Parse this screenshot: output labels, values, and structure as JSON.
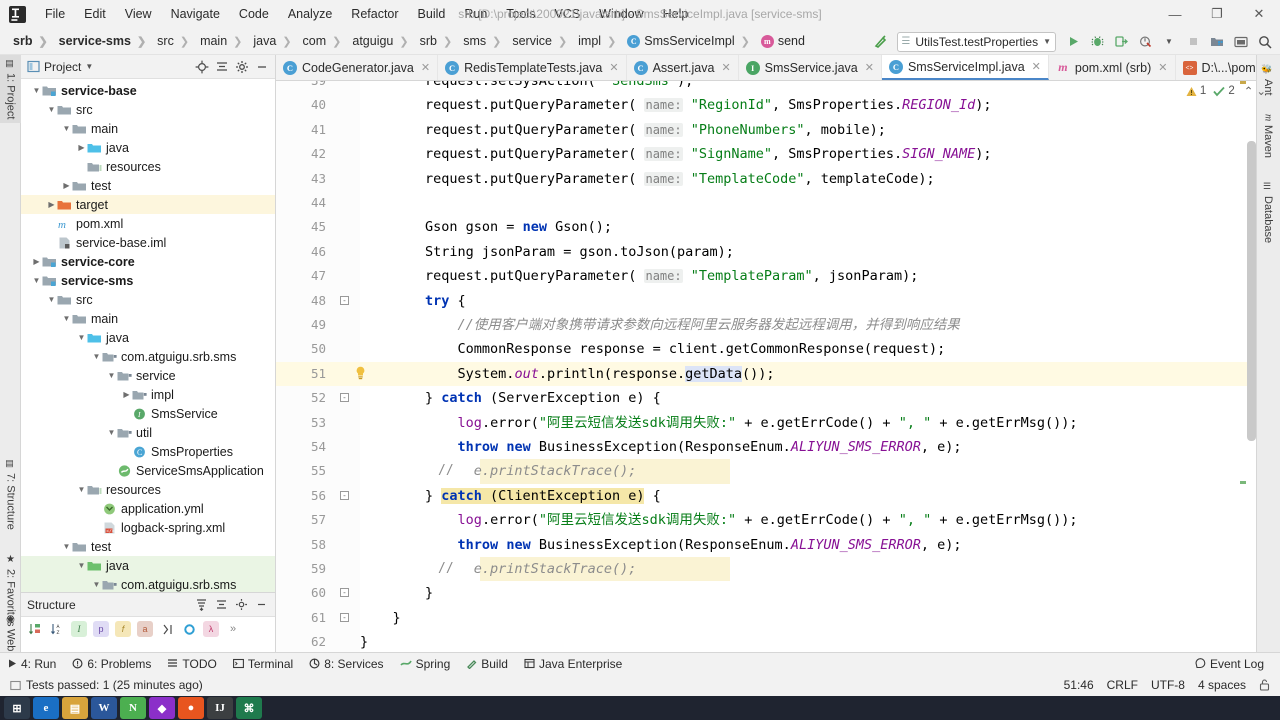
{
  "window": {
    "title": "srb [D:\\project\\200921\\java\\srb] - SmsServiceImpl.java [service-sms]",
    "minimize": "—",
    "maximize": "❐",
    "close": "✕"
  },
  "menubar": {
    "items": [
      {
        "label": "File"
      },
      {
        "label": "Edit"
      },
      {
        "label": "View"
      },
      {
        "label": "Navigate"
      },
      {
        "label": "Code"
      },
      {
        "label": "Analyze"
      },
      {
        "label": "Refactor"
      },
      {
        "label": "Build"
      },
      {
        "label": "Run"
      },
      {
        "label": "Tools"
      },
      {
        "label": "VCS"
      },
      {
        "label": "Window"
      },
      {
        "label": "Help"
      }
    ]
  },
  "breadcrumbs": {
    "items": [
      {
        "label": "srb",
        "bold": true,
        "icon": ""
      },
      {
        "label": "service-sms",
        "bold": true,
        "icon": ""
      },
      {
        "label": "src",
        "bold": false,
        "icon": ""
      },
      {
        "label": "main",
        "bold": false,
        "icon": ""
      },
      {
        "label": "java",
        "bold": false,
        "icon": ""
      },
      {
        "label": "com",
        "bold": false,
        "icon": ""
      },
      {
        "label": "atguigu",
        "bold": false,
        "icon": ""
      },
      {
        "label": "srb",
        "bold": false,
        "icon": ""
      },
      {
        "label": "sms",
        "bold": false,
        "icon": ""
      },
      {
        "label": "service",
        "bold": false,
        "icon": ""
      },
      {
        "label": "impl",
        "bold": false,
        "icon": ""
      },
      {
        "label": "SmsServiceImpl",
        "bold": false,
        "icon": "class-icon"
      },
      {
        "label": "send",
        "bold": false,
        "icon": "method-icon"
      }
    ]
  },
  "toolbar": {
    "run_config": "UtilsTest.testProperties",
    "icons": [
      "build-icon",
      "run-icon",
      "debug-icon",
      "run-coverage-icon",
      "profile-icon",
      "stop-icon",
      "project-structure-icon",
      "settings-layout-icon",
      "search-icon"
    ]
  },
  "left_tool_strip": {
    "tabs": [
      {
        "label": "1: Project",
        "selected": true,
        "icon": "project-icon"
      },
      {
        "label": "7: Structure",
        "selected": false,
        "icon": "structure-icon"
      },
      {
        "label": "2: Favorites",
        "selected": false,
        "icon": "star-icon"
      },
      {
        "label": "Web",
        "selected": false,
        "icon": "web-icon"
      }
    ]
  },
  "right_tool_strip": {
    "tabs": [
      {
        "label": "Ant",
        "icon": "ant-icon"
      },
      {
        "label": "Maven",
        "icon": "maven-icon"
      },
      {
        "label": "Database",
        "icon": "database-icon"
      }
    ]
  },
  "project_panel": {
    "title": "Project",
    "actions": [
      "locate-icon",
      "expand-collapse-icon",
      "gear-icon",
      "minimize-icon"
    ],
    "tree": [
      {
        "depth": 1,
        "arrow": "down",
        "icon": "module-icon",
        "label": "service-base",
        "bold": true,
        "hl": ""
      },
      {
        "depth": 2,
        "arrow": "down",
        "icon": "folder-icon",
        "label": "src",
        "bold": false,
        "hl": ""
      },
      {
        "depth": 3,
        "arrow": "down",
        "icon": "folder-icon",
        "label": "main",
        "bold": false,
        "hl": ""
      },
      {
        "depth": 4,
        "arrow": "right",
        "icon": "source-icon",
        "label": "java",
        "bold": false,
        "hl": ""
      },
      {
        "depth": 4,
        "arrow": "none",
        "icon": "resource-icon",
        "label": "resources",
        "bold": false,
        "hl": ""
      },
      {
        "depth": 3,
        "arrow": "right",
        "icon": "folder-icon",
        "label": "test",
        "bold": false,
        "hl": ""
      },
      {
        "depth": 2,
        "arrow": "right",
        "icon": "target-icon",
        "label": "target",
        "bold": false,
        "hl": "yellow"
      },
      {
        "depth": 2,
        "arrow": "none",
        "icon": "maven-pom-icon",
        "label": "pom.xml",
        "bold": false,
        "hl": ""
      },
      {
        "depth": 2,
        "arrow": "none",
        "icon": "iml-icon",
        "label": "service-base.iml",
        "bold": false,
        "hl": ""
      },
      {
        "depth": 1,
        "arrow": "right",
        "icon": "module-icon",
        "label": "service-core",
        "bold": true,
        "hl": ""
      },
      {
        "depth": 1,
        "arrow": "down",
        "icon": "module-icon",
        "label": "service-sms",
        "bold": true,
        "hl": ""
      },
      {
        "depth": 2,
        "arrow": "down",
        "icon": "folder-icon",
        "label": "src",
        "bold": false,
        "hl": ""
      },
      {
        "depth": 3,
        "arrow": "down",
        "icon": "folder-icon",
        "label": "main",
        "bold": false,
        "hl": ""
      },
      {
        "depth": 4,
        "arrow": "down",
        "icon": "source-icon",
        "label": "java",
        "bold": false,
        "hl": ""
      },
      {
        "depth": 5,
        "arrow": "down",
        "icon": "package-icon",
        "label": "com.atguigu.srb.sms",
        "bold": false,
        "hl": ""
      },
      {
        "depth": 6,
        "arrow": "down",
        "icon": "package-icon",
        "label": "service",
        "bold": false,
        "hl": ""
      },
      {
        "depth": 7,
        "arrow": "right",
        "icon": "package-icon",
        "label": "impl",
        "bold": false,
        "hl": ""
      },
      {
        "depth": 7,
        "arrow": "none",
        "icon": "interface-icon",
        "label": "SmsService",
        "bold": false,
        "hl": ""
      },
      {
        "depth": 6,
        "arrow": "down",
        "icon": "package-icon",
        "label": "util",
        "bold": false,
        "hl": ""
      },
      {
        "depth": 7,
        "arrow": "none",
        "icon": "class-icon",
        "label": "SmsProperties",
        "bold": false,
        "hl": ""
      },
      {
        "depth": 6,
        "arrow": "none",
        "icon": "spring-icon",
        "label": "ServiceSmsApplication",
        "bold": false,
        "hl": ""
      },
      {
        "depth": 4,
        "arrow": "down",
        "icon": "resource-icon",
        "label": "resources",
        "bold": false,
        "hl": ""
      },
      {
        "depth": 5,
        "arrow": "none",
        "icon": "yml-icon",
        "label": "application.yml",
        "bold": false,
        "hl": ""
      },
      {
        "depth": 5,
        "arrow": "none",
        "icon": "xml-icon",
        "label": "logback-spring.xml",
        "bold": false,
        "hl": ""
      },
      {
        "depth": 3,
        "arrow": "down",
        "icon": "folder-icon",
        "label": "test",
        "bold": false,
        "hl": ""
      },
      {
        "depth": 4,
        "arrow": "down",
        "icon": "testsrc-icon",
        "label": "java",
        "bold": false,
        "hl": "green"
      },
      {
        "depth": 5,
        "arrow": "down",
        "icon": "package-icon",
        "label": "com.atguigu.srb.sms",
        "bold": false,
        "hl": "green"
      }
    ]
  },
  "structure_panel": {
    "title": "Structure",
    "actions": [
      "sort-icon",
      "expand-icon",
      "gear-icon",
      "minimize-icon"
    ],
    "toolbar_icons": [
      "sort-by-type-icon",
      "sort-alphabetically-icon",
      "show-inherited-icon",
      "show-properties-icon",
      "show-fields-icon",
      "show-non-public-icon",
      "show-anonymous-icon",
      "show-constants-icon",
      "show-lambdas-icon",
      "more-icon"
    ]
  },
  "editor_tabs": {
    "tabs": [
      {
        "label": "CodeGenerator.java",
        "icon": "class-icon",
        "active": false
      },
      {
        "label": "RedisTemplateTests.java",
        "icon": "class-icon",
        "active": false
      },
      {
        "label": "Assert.java",
        "icon": "class-icon",
        "active": false
      },
      {
        "label": "SmsService.java",
        "icon": "interface-icon",
        "active": false
      },
      {
        "label": "SmsServiceImpl.java",
        "icon": "class-icon",
        "active": true
      },
      {
        "label": "pom.xml (srb)",
        "icon": "maven-icon",
        "active": false
      },
      {
        "label": "D:\\...\\pom",
        "icon": "xml-icon",
        "active": false
      }
    ],
    "overflow": "⌄",
    "close_glyph": "✕"
  },
  "inspections": {
    "warning_count": "1",
    "ok_count": "2",
    "up_glyph": "⌃",
    "down_glyph": "⌄"
  },
  "code": {
    "first_line_number": 39,
    "current_line": 51,
    "lines": [
      {
        "n": 39,
        "text": "        request.setSysAction( \"SendSms\");",
        "partial": true
      },
      {
        "n": 40,
        "text": "        request.putQueryParameter( name: \"RegionId\", SmsProperties.REGION_Id);"
      },
      {
        "n": 41,
        "text": "        request.putQueryParameter( name: \"PhoneNumbers\", mobile);"
      },
      {
        "n": 42,
        "text": "        request.putQueryParameter( name: \"SignName\", SmsProperties.SIGN_NAME);"
      },
      {
        "n": 43,
        "text": "        request.putQueryParameter( name: \"TemplateCode\", templateCode);"
      },
      {
        "n": 44,
        "text": ""
      },
      {
        "n": 45,
        "text": "        Gson gson = new Gson();"
      },
      {
        "n": 46,
        "text": "        String jsonParam = gson.toJson(param);"
      },
      {
        "n": 47,
        "text": "        request.putQueryParameter( name: \"TemplateParam\", jsonParam);"
      },
      {
        "n": 48,
        "text": "        try {"
      },
      {
        "n": 49,
        "text": "            //使用客户端对象携带请求参数向远程阿里云服务器发起远程调用，并得到响应结果"
      },
      {
        "n": 50,
        "text": "            CommonResponse response = client.getCommonResponse(request);"
      },
      {
        "n": 51,
        "text": "            System.out.println(response.getData());"
      },
      {
        "n": 52,
        "text": "        } catch (ServerException e) {"
      },
      {
        "n": 53,
        "text": "            log.error(\"阿里云短信发送sdk调用失败:\" + e.getErrCode() + \", \" + e.getErrMsg());"
      },
      {
        "n": 54,
        "text": "            throw new BusinessException(ResponseEnum.ALIYUN_SMS_ERROR, e);"
      },
      {
        "n": 55,
        "text": "              e.printStackTrace();",
        "gutter_comment": "//"
      },
      {
        "n": 56,
        "text": "        } catch (ClientException e) {"
      },
      {
        "n": 57,
        "text": "            log.error(\"阿里云短信发送sdk调用失败:\" + e.getErrCode() + \", \" + e.getErrMsg());"
      },
      {
        "n": 58,
        "text": "            throw new BusinessException(ResponseEnum.ALIYUN_SMS_ERROR, e);"
      },
      {
        "n": 59,
        "text": "              e.printStackTrace();",
        "gutter_comment": "//"
      },
      {
        "n": 60,
        "text": "        }"
      },
      {
        "n": 61,
        "text": "    }"
      },
      {
        "n": 62,
        "text": "}"
      }
    ]
  },
  "bottom_bar": {
    "items": [
      {
        "label": "4: Run",
        "icon": "run-icon"
      },
      {
        "label": "6: Problems",
        "icon": "problems-icon"
      },
      {
        "label": "TODO",
        "icon": "todo-icon"
      },
      {
        "label": "Terminal",
        "icon": "terminal-icon"
      },
      {
        "label": "8: Services",
        "icon": "services-icon"
      },
      {
        "label": "Spring",
        "icon": "spring-icon"
      },
      {
        "label": "Build",
        "icon": "build-icon"
      },
      {
        "label": "Java Enterprise",
        "icon": "java-enterprise-icon"
      }
    ],
    "event_log": "Event Log"
  },
  "status_bar": {
    "message": "Tests passed: 1 (25 minutes ago)",
    "caret_position": "51:46",
    "line_separator": "CRLF",
    "encoding": "UTF-8",
    "indent": "4 spaces",
    "lock_icon": "lock-icon"
  },
  "taskbar": {
    "items": [
      {
        "label": "⊞",
        "color": "#2d3a4a"
      },
      {
        "label": "e",
        "color": "#1a6fc4"
      },
      {
        "label": "▤",
        "color": "#d8a43c"
      },
      {
        "label": "W",
        "color": "#2b579a"
      },
      {
        "label": "N",
        "color": "#4caf50"
      },
      {
        "label": "◆",
        "color": "#8b2fc9"
      },
      {
        "label": "●",
        "color": "#e8551f"
      },
      {
        "label": "IJ",
        "color": "#3c3f41"
      },
      {
        "label": "⌘",
        "color": "#1f7a4d"
      }
    ]
  },
  "colors": {
    "accent": "#4a86c8",
    "keyword": "#0033b3",
    "string": "#067d17",
    "comment": "#8c8c8c",
    "static_field": "#871094",
    "current_line_bg": "#fffae3",
    "tree_target_hl": "#fdf6dd",
    "tree_test_hl": "#eaf5e4"
  }
}
